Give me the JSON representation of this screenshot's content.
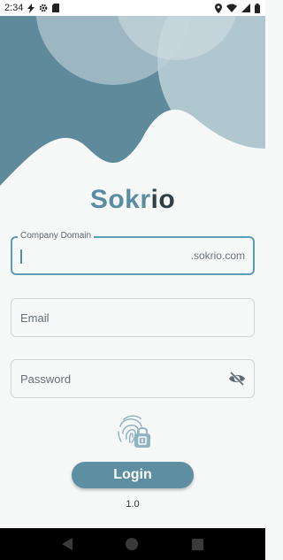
{
  "status_bar": {
    "time": "2:34",
    "left_icons": [
      "bolt-icon",
      "gear-icon",
      "sd-card-icon"
    ],
    "right_icons": [
      "location-icon",
      "wifi-icon",
      "signal-icon",
      "battery-icon"
    ]
  },
  "colors": {
    "brand": "#5a8da1",
    "dark": "#2e3f47",
    "field_focus": "#5a9db5",
    "background": "#f6f7f7"
  },
  "logo": {
    "main": "Sokr",
    "accent": "io"
  },
  "company_field": {
    "label": "Company Domain",
    "value": "",
    "suffix": ".sokrio.com"
  },
  "email_field": {
    "placeholder": "Email"
  },
  "password_field": {
    "placeholder": "Password",
    "icon": "eye-off-icon"
  },
  "fingerprint": {
    "icon": "fingerprint-lock-icon"
  },
  "login": {
    "label": "Login"
  },
  "version": "1.0",
  "nav_bar": {
    "icons": [
      "back-icon",
      "home-icon",
      "recents-icon"
    ]
  }
}
